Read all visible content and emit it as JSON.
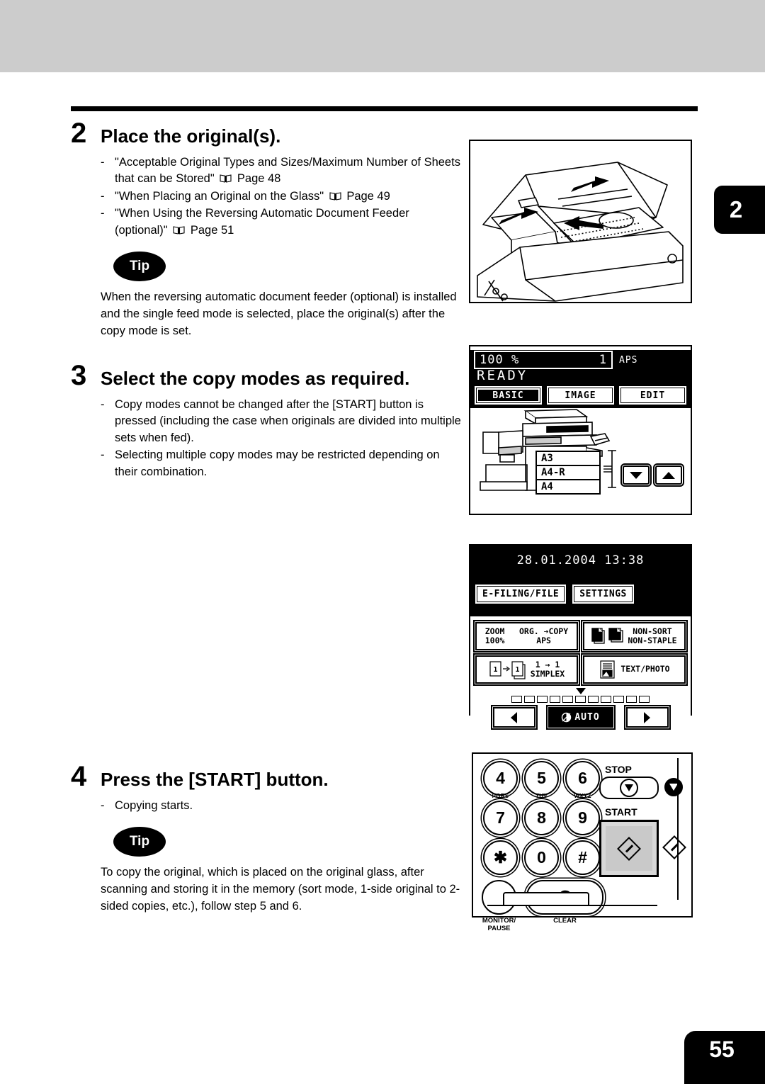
{
  "page": {
    "page_number": "55",
    "chapter_tab": "2"
  },
  "steps": [
    {
      "number": "2",
      "title": "Place the original(s).",
      "bullets": [
        {
          "pre": "\"Acceptable Original Types and Sizes/Maximum Number of Sheets that can be Stored\"",
          "icon": "book-icon",
          "post": "Page 48"
        },
        {
          "pre": "\"When Placing an Original on the Glass\"",
          "icon": "book-icon",
          "post": "Page 49"
        },
        {
          "pre": "\"When Using the Reversing Automatic Document Feeder (optional)\"",
          "icon": "book-icon",
          "post": "Page 51"
        }
      ],
      "tip": {
        "label": "Tip",
        "text": "When the reversing automatic document feeder (optional) is installed and the single feed mode is selected, place the original(s) after the copy mode is set."
      }
    },
    {
      "number": "3",
      "title": "Select the copy modes as required.",
      "bullets": [
        {
          "pre": "Copy modes cannot be changed after the [START] button is pressed (including the case when originals are divided into multiple sets when fed).",
          "icon": "",
          "post": ""
        },
        {
          "pre": "Selecting multiple copy modes may be restricted depending on their combination.",
          "icon": "",
          "post": ""
        }
      ]
    },
    {
      "number": "4",
      "title": "Press the [START] button.",
      "bullets": [
        {
          "pre": "Copying starts.",
          "icon": "",
          "post": ""
        }
      ],
      "tip": {
        "label": "Tip",
        "text": "To copy the original, which is placed on the original glass, after scanning and storing it in the memory (sort mode, 1-side original to 2-sided copies, etc.), follow step 5 and 6."
      }
    }
  ],
  "illustrations": {
    "feeder": {
      "caption": "reversing-automatic-document-feeder"
    }
  },
  "lcd_basic": {
    "zoom_ratio": "100",
    "percent_sign": "%",
    "copy_count": "1",
    "paper_mode": "APS",
    "status": "READY",
    "tabs": [
      {
        "label": "BASIC",
        "selected": true
      },
      {
        "label": "IMAGE",
        "selected": false
      },
      {
        "label": "EDIT",
        "selected": false
      }
    ],
    "drawers": [
      "A3",
      "A4-R",
      "A4"
    ],
    "scroll_down": "down-arrow",
    "scroll_up": "up-arrow"
  },
  "lcd_settings": {
    "datetime": "28.01.2004 13:38",
    "tabs": [
      {
        "label": "E-FILING/FILE"
      },
      {
        "label": "SETTINGS"
      }
    ],
    "modes": [
      {
        "line1": "ZOOM",
        "line2": "100%",
        "line3": "ORG. ➔COPY",
        "line4": "APS",
        "kind": "zoom"
      },
      {
        "line1": "NON-SORT",
        "line2": "NON-STAPLE",
        "kind": "finishing"
      },
      {
        "line1": "1 → 1",
        "line2": "SIMPLEX",
        "kind": "duplex"
      },
      {
        "line1": "TEXT/PHOTO",
        "kind": "original-mode"
      }
    ],
    "density": {
      "segments": 11,
      "pointer_index": 6,
      "auto_label": "AUTO",
      "lighter": "lighter-icon",
      "darker": "darker-icon",
      "auto_selected": true
    }
  },
  "keypad": {
    "keys": [
      {
        "label": "4",
        "sub": ""
      },
      {
        "label": "5",
        "sub": ""
      },
      {
        "label": "6",
        "sub": ""
      },
      {
        "label": "7",
        "sub": "PQRS"
      },
      {
        "label": "8",
        "sub": "TUV"
      },
      {
        "label": "9",
        "sub": "WXYZ"
      },
      {
        "label": "✱",
        "sub": ""
      },
      {
        "label": "0",
        "sub": ""
      },
      {
        "label": "#",
        "sub": ""
      }
    ],
    "monitor_pause_line1": "MONITOR/",
    "monitor_pause_line2": "PAUSE",
    "clear_key": "C",
    "clear_label": "CLEAR",
    "stop_label": "STOP",
    "start_label": "START"
  }
}
